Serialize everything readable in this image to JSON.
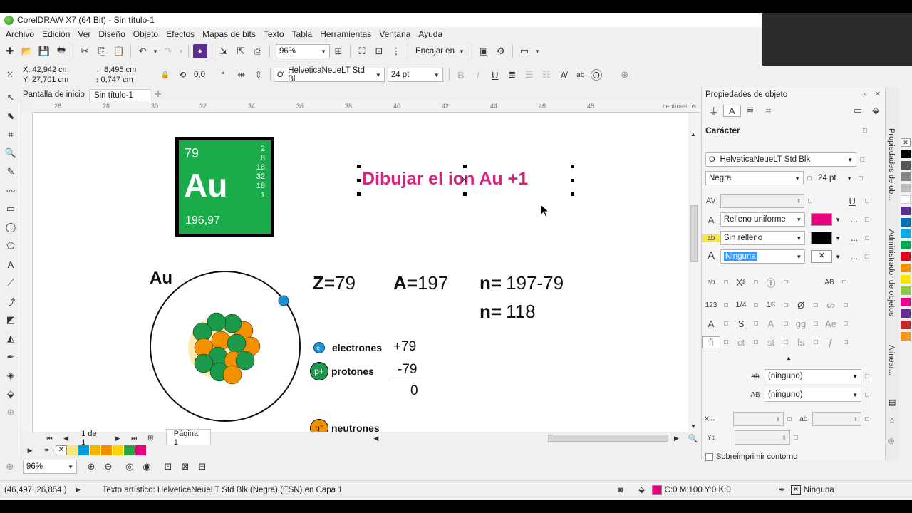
{
  "window": {
    "title": "CorelDRAW X7 (64 Bit) - Sin título-1"
  },
  "menu": [
    "Archivo",
    "Edición",
    "Ver",
    "Diseño",
    "Objeto",
    "Efectos",
    "Mapas de bits",
    "Texto",
    "Tabla",
    "Herramientas",
    "Ventana",
    "Ayuda"
  ],
  "toolbar": {
    "zoom": "96%",
    "snap": "Encajar en"
  },
  "propbar": {
    "x": "X: 42,942 cm",
    "y": "Y: 27,701 cm",
    "w": "8,495 cm",
    "h": "0,747 cm",
    "angle": "0,0",
    "degree": "°",
    "font": "HelveticaNeueLT Std Bl",
    "size": "24 pt"
  },
  "doc_tabs": [
    "Pantalla de inicio",
    "Sin título-1"
  ],
  "ruler": {
    "labels": [
      "26",
      "28",
      "30",
      "32",
      "34",
      "36",
      "38",
      "40",
      "42",
      "44",
      "46",
      "48"
    ],
    "unit": "centímetros"
  },
  "canvas": {
    "element": {
      "number": "79",
      "symbol": "Au",
      "mass": "196,97",
      "shells": [
        "2",
        "8",
        "18",
        "32",
        "18",
        "1"
      ]
    },
    "title": "Dibujar el ion Au +1",
    "atom_label": "Au",
    "z_label": "Z=",
    "z_value": "79",
    "a_label": "A=",
    "a_value": "197",
    "n_label": "n=",
    "n_value": "197-79",
    "n2_label": "n=",
    "n2_value": "118",
    "legend": {
      "electron_badge": "e-",
      "electron_label": "electrones",
      "proton_badge": "p+",
      "proton_label": "protones",
      "neutron_badge": "n°",
      "neutron_label": "neutrones"
    },
    "calc": {
      "plus": "+79",
      "minus": "-79",
      "result": "0"
    }
  },
  "pagebar": {
    "pages": "1 de 1",
    "page_tab": "Página 1"
  },
  "zoombar": {
    "zoom": "96%"
  },
  "status": {
    "coords": "(46,497; 26,854 )",
    "description": "Texto artístico: HelveticaNeueLT Std Blk (Negra) (ESN) en Capa 1",
    "fill": "C:0 M:100 Y:0 K:0",
    "outline": "Ninguna"
  },
  "docker": {
    "title": "Propiedades de objeto",
    "section": "Carácter",
    "font": "HelveticaNeueLT Std Blk",
    "weight": "Negra",
    "size": "24 pt",
    "fill_type": "Relleno uniforme",
    "bg_fill": "Sin relleno",
    "outline": "Ninguna",
    "strike": "(ninguno)",
    "caps": "(ninguno)",
    "overprint": "Sobreimprimir contorno",
    "more": "..."
  },
  "side_tabs": [
    "Propiedades de ob...",
    "Administrador de objetos",
    "Alinear..."
  ],
  "colors": {
    "fill_magenta": "#e6007e",
    "atom_green": "#1a9a4a",
    "atom_orange": "#f39000",
    "electron_blue": "#1b8fd0",
    "title_magenta": "#d6237d",
    "palette": [
      "#fbe57f",
      "#009ee0",
      "#f7b500",
      "#f39000",
      "#ffd400",
      "#28a745",
      "#e6007e"
    ],
    "right_palette": [
      "#000000",
      "#555555",
      "#888888",
      "#bbbbbb",
      "#ffffff",
      "#e2001a",
      "#f39000",
      "#ffe500",
      "#00a651",
      "#0072bc",
      "#5b2d8e",
      "#e6007e",
      "#00aeef",
      "#8dc63f",
      "#f7941d",
      "#c1272d",
      "#662d91",
      "#ec008c"
    ]
  }
}
